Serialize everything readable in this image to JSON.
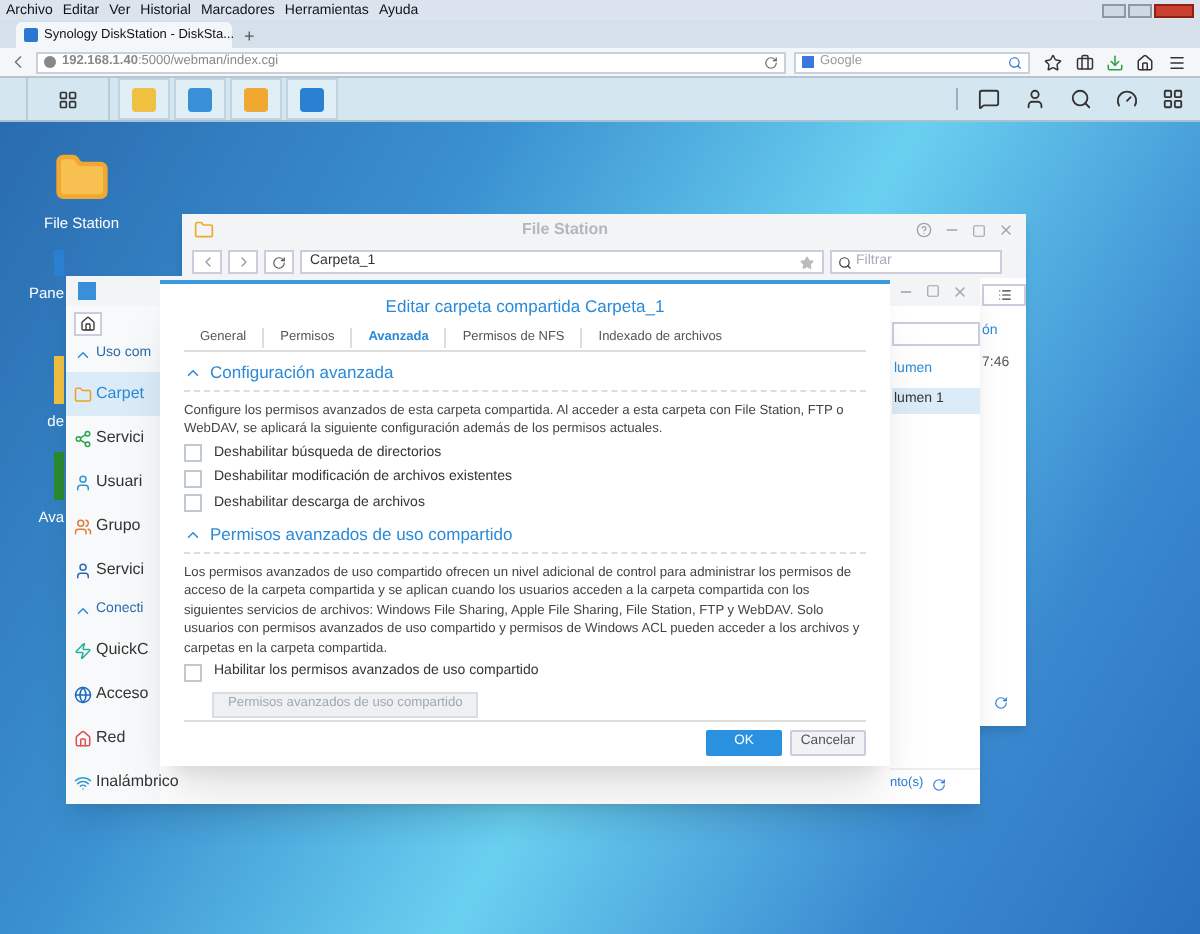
{
  "browser": {
    "menu": [
      "Archivo",
      "Editar",
      "Ver",
      "Historial",
      "Marcadores",
      "Herramientas",
      "Ayuda"
    ],
    "tabs": [
      {
        "title": "Synology DiskStation - DiskSta...",
        "selected": true
      }
    ],
    "new_tab": "+",
    "url": "**192.168.1.40**:5000/webman/index.cgi",
    "search_placeholder": "Google"
  },
  "desktop_icons": [
    {
      "label": "File Station"
    },
    {
      "label": "Pane"
    },
    {
      "label": "de"
    },
    {
      "label": "Ava"
    }
  ],
  "file_station": {
    "title": "File Station",
    "path": "Carpeta_1",
    "filter_placeholder": "Filtrar",
    "column": "ón",
    "cell": "7:46"
  },
  "control_panel": {
    "sidebar": [
      {
        "kind": "section",
        "label": "Uso com",
        "expanded": true
      },
      {
        "kind": "item",
        "label": "Carpet",
        "selected": true
      },
      {
        "kind": "item",
        "label": "Servici",
        "selected": false
      },
      {
        "kind": "item",
        "label": "Usuari",
        "selected": false
      },
      {
        "kind": "item",
        "label": "Grupo",
        "selected": false
      },
      {
        "kind": "item",
        "label": "Servici",
        "selected": false
      },
      {
        "kind": "section",
        "label": "Conecti",
        "expanded": true
      },
      {
        "kind": "item",
        "label": "QuickC",
        "selected": false
      },
      {
        "kind": "item",
        "label": "Acceso",
        "selected": false
      },
      {
        "kind": "item",
        "label": "Red",
        "selected": false
      },
      {
        "kind": "item",
        "label": "Inalámbrico",
        "selected": false
      }
    ],
    "column": "lumen",
    "row": {
      "label": "lumen 1",
      "selected": true
    },
    "status": "nto(s)"
  },
  "dialog": {
    "title": "Editar carpeta compartida Carpeta_1",
    "tabs": [
      {
        "label": "General",
        "selected": false
      },
      {
        "label": "Permisos",
        "selected": false
      },
      {
        "label": "Avanzada",
        "selected": true
      },
      {
        "label": "Permisos de NFS",
        "selected": false
      },
      {
        "label": "Indexado de archivos",
        "selected": false
      }
    ],
    "sections": [
      {
        "title": "Configuración avanzada",
        "expanded": true,
        "text": "Configure los permisos avanzados de esta carpeta compartida. Al acceder a esta carpeta con File Station, FTP o WebDAV, se aplicará la siguiente configuración además de los permisos actuales.",
        "options": [
          {
            "label": "Deshabilitar búsqueda de directorios",
            "checked": false
          },
          {
            "label": "Deshabilitar modificación de archivos existentes",
            "checked": false
          },
          {
            "label": "Deshabilitar descarga de archivos",
            "checked": false
          }
        ]
      },
      {
        "title": "Permisos avanzados de uso compartido",
        "expanded": true,
        "text": "Los permisos avanzados de uso compartido ofrecen un nivel adicional de control para administrar los permisos de acceso de la carpeta compartida y se aplican cuando los usuarios acceden a la carpeta compartida con los siguientes servicios de archivos: Windows File Sharing, Apple File Sharing, File Station, FTP y WebDAV. Solo usuarios con permisos avanzados de uso compartido y permisos de Windows ACL pueden acceder a los archivos y carpetas en la carpeta compartida.",
        "options": [
          {
            "label": "Habilitar los permisos avanzados de uso compartido",
            "checked": false
          }
        ],
        "button": {
          "label": "Permisos avanzados de uso compartido",
          "disabled": true
        }
      }
    ],
    "buttons": [
      {
        "label": "OK",
        "kind": "primary"
      },
      {
        "label": "Cancelar",
        "kind": "secondary"
      }
    ]
  }
}
